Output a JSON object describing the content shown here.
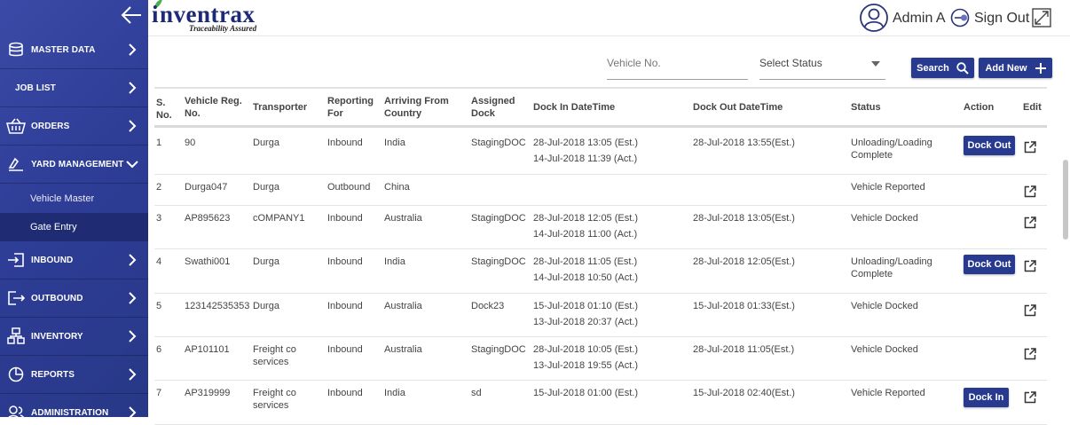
{
  "brand": {
    "name": "nventrax",
    "tagline": "Traceability Assured"
  },
  "header": {
    "user_name": "Admin A",
    "sign_out": "Sign Out"
  },
  "sidebar": {
    "items": [
      {
        "label": "MASTER DATA",
        "icon": "database-icon",
        "chevron": "right"
      },
      {
        "label": "JOB LIST",
        "icon": "",
        "chevron": "right"
      },
      {
        "label": "ORDERS",
        "icon": "basket-icon",
        "chevron": "right"
      },
      {
        "label": "YARD MANAGEMENT",
        "icon": "truck-icon",
        "chevron": "down"
      },
      {
        "label": "INBOUND",
        "icon": "inbound-icon",
        "chevron": "right"
      },
      {
        "label": "OUTBOUND",
        "icon": "outbound-icon",
        "chevron": "right"
      },
      {
        "label": "INVENTORY",
        "icon": "inventory-icon",
        "chevron": "right"
      },
      {
        "label": "REPORTS",
        "icon": "pie-chart-icon",
        "chevron": "right"
      },
      {
        "label": "ADMINISTRATION",
        "icon": "users-icon",
        "chevron": "right"
      }
    ],
    "sub_items": [
      {
        "label": "Vehicle Master"
      },
      {
        "label": "Gate Entry"
      }
    ]
  },
  "filters": {
    "vehicle_placeholder": "Vehicle No.",
    "status_selected": "Select Status",
    "search_label": "Search",
    "add_new_label": "Add New"
  },
  "table": {
    "headers": {
      "sno": [
        "S.",
        "No."
      ],
      "vehicle": [
        "Vehicle Reg.",
        "No."
      ],
      "transporter": "Transporter",
      "reporting": [
        "Reporting",
        "For"
      ],
      "arriving": [
        "Arriving From",
        "Country"
      ],
      "dock": [
        "Assigned",
        "Dock"
      ],
      "dock_in": "Dock In DateTime",
      "dock_out": "Dock Out DateTime",
      "status": "Status",
      "action": "Action",
      "edit": "Edit"
    },
    "rows": [
      {
        "sno": "1",
        "vehicle": "90",
        "transporter": [
          "Durga"
        ],
        "reporting": "Inbound",
        "country": "India",
        "dock": "StagingDOC",
        "dock_in": [
          "28-Jul-2018 13:05 (Est.)",
          "14-Jul-2018 11:39 (Act.)"
        ],
        "dock_out": "28-Jul-2018 13:55(Est.)",
        "status": [
          "Unloading/Loading",
          "Complete"
        ],
        "action": "Dock Out"
      },
      {
        "sno": "2",
        "vehicle": "Durga047",
        "transporter": [
          "Durga"
        ],
        "reporting": "Outbound",
        "country": "China",
        "dock": "",
        "dock_in": [
          "",
          ""
        ],
        "dock_out": "",
        "status": [
          "Vehicle Reported",
          ""
        ],
        "action": ""
      },
      {
        "sno": "3",
        "vehicle": "AP895623",
        "transporter": [
          "cOMPANY1"
        ],
        "reporting": "Inbound",
        "country": "Australia",
        "dock": "StagingDOC",
        "dock_in": [
          "28-Jul-2018 12:05 (Est.)",
          "14-Jul-2018 11:00 (Act.)"
        ],
        "dock_out": "28-Jul-2018 13:05(Est.)",
        "status": [
          "Vehicle Docked",
          ""
        ],
        "action": ""
      },
      {
        "sno": "4",
        "vehicle": "Swathi001",
        "transporter": [
          "Durga"
        ],
        "reporting": "Inbound",
        "country": "India",
        "dock": "StagingDOC",
        "dock_in": [
          "28-Jul-2018 11:05 (Est.)",
          "14-Jul-2018 10:50 (Act.)"
        ],
        "dock_out": "28-Jul-2018 12:05(Est.)",
        "status": [
          "Unloading/Loading",
          "Complete"
        ],
        "action": "Dock Out"
      },
      {
        "sno": "5",
        "vehicle": "123142535353",
        "transporter": [
          "Durga"
        ],
        "reporting": "Inbound",
        "country": "Australia",
        "dock": "Dock23",
        "dock_in": [
          "15-Jul-2018 01:10 (Est.)",
          "13-Jul-2018 20:37 (Act.)"
        ],
        "dock_out": "15-Jul-2018 01:33(Est.)",
        "status": [
          "Vehicle Docked",
          ""
        ],
        "action": ""
      },
      {
        "sno": "6",
        "vehicle": "AP101101",
        "transporter": [
          "Freight co",
          "services"
        ],
        "reporting": "Inbound",
        "country": "Australia",
        "dock": "StagingDOC",
        "dock_in": [
          "28-Jul-2018 10:05 (Est.)",
          "13-Jul-2018 19:55 (Act.)"
        ],
        "dock_out": "28-Jul-2018 11:05(Est.)",
        "status": [
          "Vehicle Docked",
          ""
        ],
        "action": ""
      },
      {
        "sno": "7",
        "vehicle": "AP319999",
        "transporter": [
          "Freight co",
          "services"
        ],
        "reporting": "Inbound",
        "country": "India",
        "dock": "sd",
        "dock_in": [
          "15-Jul-2018 01:00 (Est.)",
          ""
        ],
        "dock_out": "15-Jul-2018 02:40(Est.)",
        "status": [
          "Vehicle Reported",
          ""
        ],
        "action": "Dock In"
      }
    ]
  },
  "colors": {
    "sidebar": "#2e3d96",
    "accent": "#283a8f",
    "brand": "#1e2a78",
    "leaf": "#4caf50"
  }
}
